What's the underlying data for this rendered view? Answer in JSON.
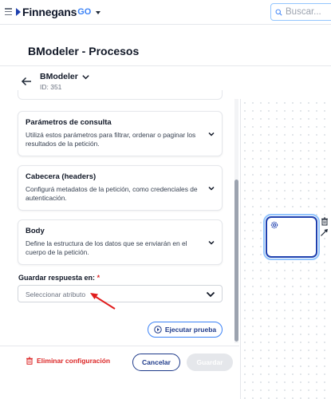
{
  "topbar": {
    "brand_name": "Finnegans",
    "brand_suffix": "GO",
    "search_placeholder": "Buscar..."
  },
  "page": {
    "title": "BModeler - Procesos"
  },
  "bmodeler": {
    "name": "BModeler",
    "id_label": "ID: 351"
  },
  "cards": [
    {
      "title": "Parámetros de consulta",
      "description": "Utilizá estos parámetros para filtrar, ordenar o paginar los resultados de la petición."
    },
    {
      "title": "Cabecera (headers)",
      "description": "Configurá metadatos de la petición, como credenciales de autenticación."
    },
    {
      "title": "Body",
      "description": "Define la estructura de los datos que se enviarán en el cuerpo de la petición."
    }
  ],
  "save_response": {
    "label": "Guardar respuesta en:",
    "required_mark": "*",
    "placeholder": "Seleccionar atributo"
  },
  "actions": {
    "test_label": "Ejecutar prueba",
    "delete_label": "Eliminar configuración",
    "cancel_label": "Cancelar",
    "save_label": "Guardar"
  },
  "colors": {
    "primary": "#1e40af",
    "accent": "#3b82f6",
    "danger": "#dc2626",
    "disabled": "#e5e7eb"
  }
}
